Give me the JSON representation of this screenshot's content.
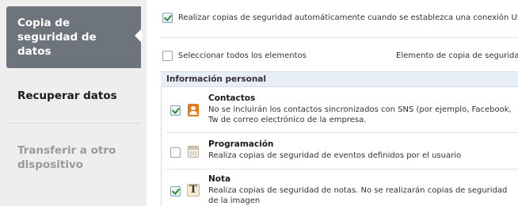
{
  "sidebar": {
    "items": [
      {
        "label": "Copia de seguridad de datos",
        "state": "active"
      },
      {
        "label": "Recuperar datos",
        "state": "normal"
      },
      {
        "label": "Transferir a otro dispositivo",
        "state": "disabled"
      }
    ]
  },
  "options": {
    "auto_backup_label": "Realizar copias de seguridad automáticamente cuando se establezca una conexión USB",
    "auto_backup_checked": true,
    "select_all_label": "Seleccionar todos los elementos",
    "select_all_checked": false,
    "backup_item_label": "Elemento de copia de seguridad s"
  },
  "section": {
    "title": "Información personal",
    "items": [
      {
        "title": "Contactos",
        "icon": "contacts-icon",
        "checked": true,
        "description": "No se incluirán los contactos sincronizados con SNS (por ejemplo, Facebook, Tw de correo electrónico de la empresa."
      },
      {
        "title": "Programación",
        "icon": "calendar-icon",
        "checked": false,
        "description": "Realiza copias de seguridad de eventos definidos por el usuario"
      },
      {
        "title": "Nota",
        "icon": "note-icon",
        "icon_glyph": "T",
        "checked": true,
        "description": "Realiza copias de seguridad de notas. No se realizarán copias de seguridad de la imagen"
      }
    ]
  },
  "colors": {
    "sidebar_bg": "#eeeeee",
    "active_item_bg": "#6d747c",
    "section_header_bg": "#e7eef6"
  }
}
